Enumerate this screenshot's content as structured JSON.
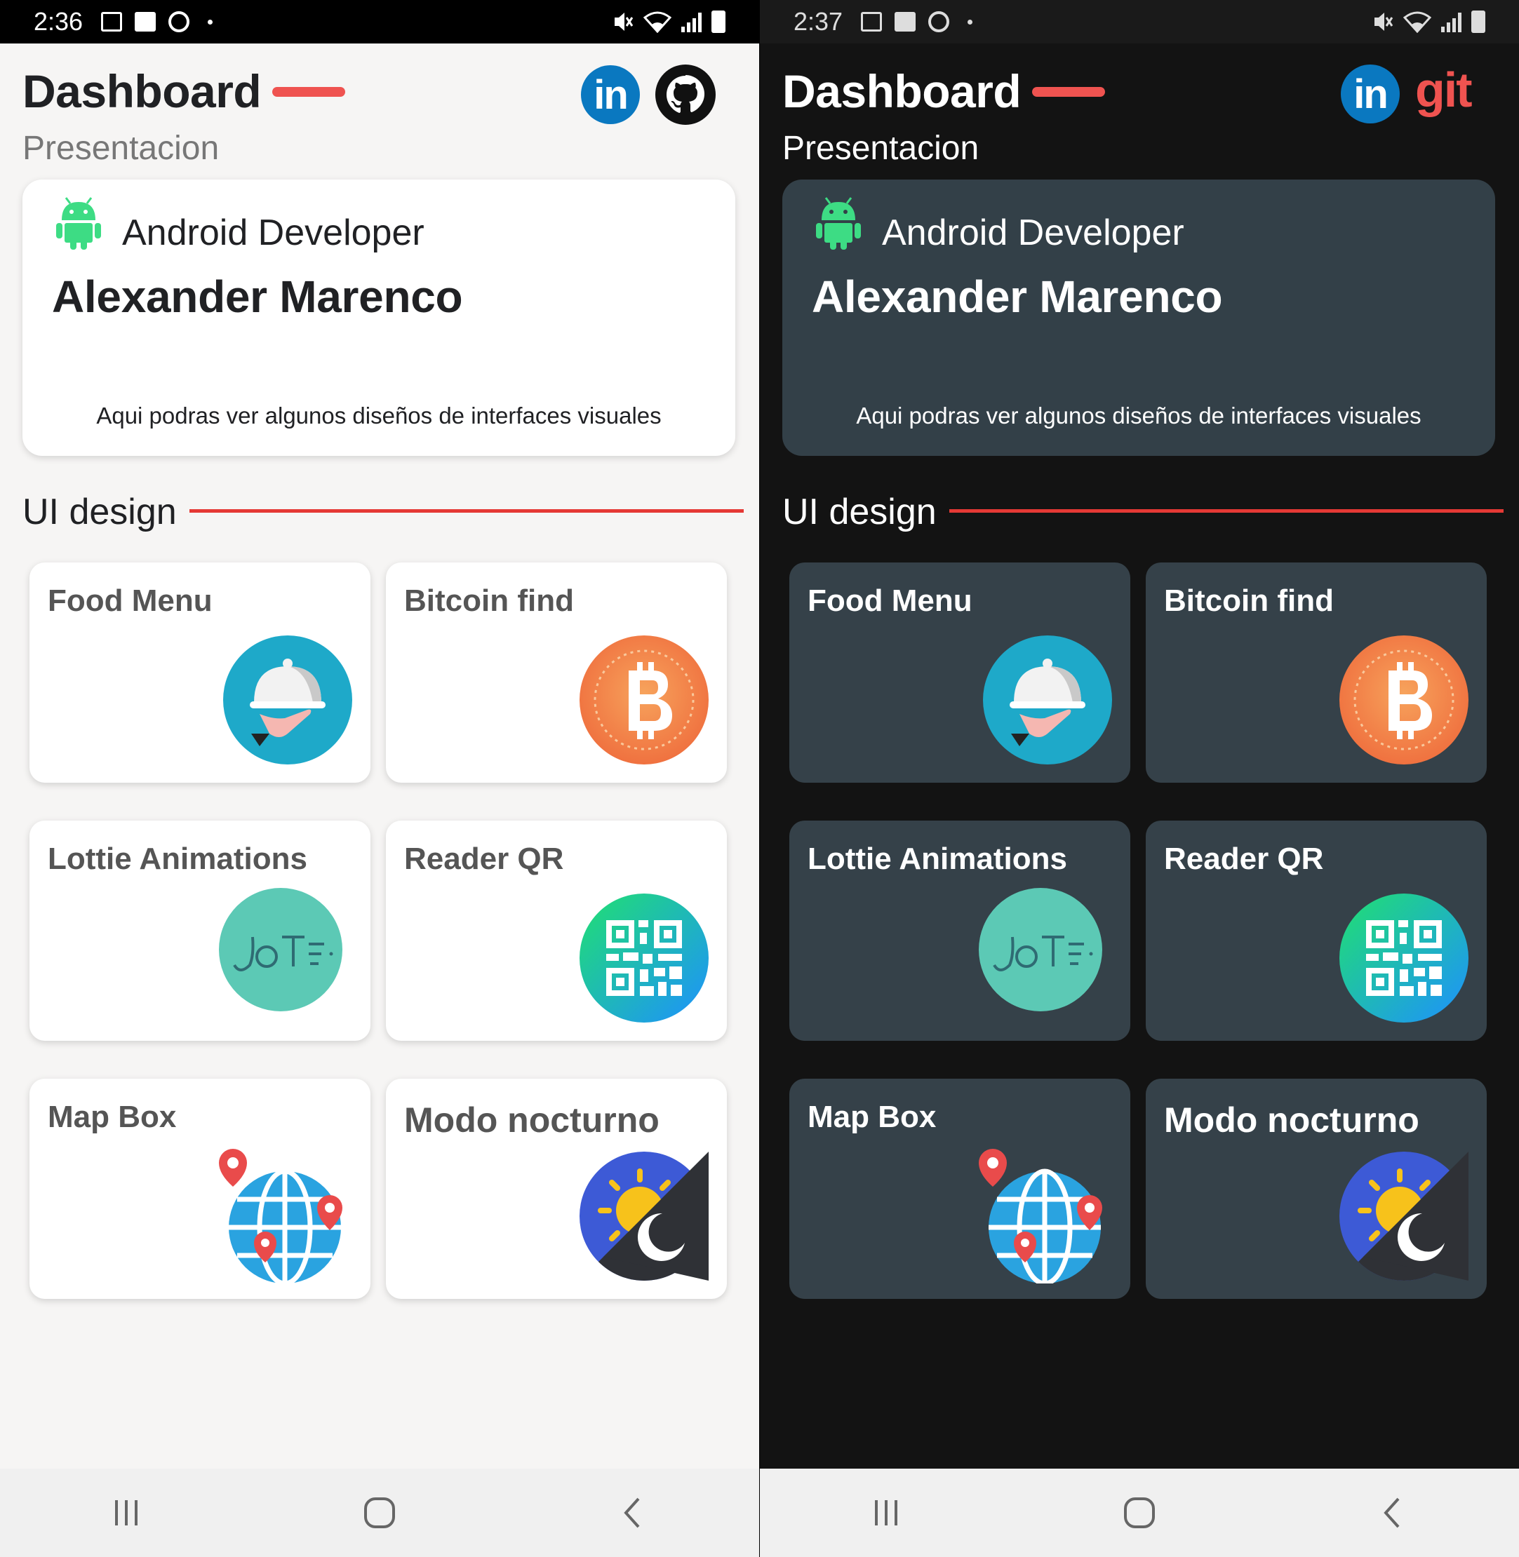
{
  "screens": [
    {
      "theme": "light",
      "status": {
        "time": "2:36"
      },
      "header": {
        "title": "Dashboard",
        "subtitle": "Presentacion",
        "linkedin_label": "in"
      },
      "profile": {
        "role": "Android Developer",
        "name": "Alexander Marenco",
        "tagline": "Aqui podras ver algunos diseños de interfaces visuales"
      },
      "section": {
        "title": "UI design"
      },
      "tiles": [
        {
          "label": "Food Menu",
          "icon": "food-menu-icon"
        },
        {
          "label": "Bitcoin find",
          "icon": "bitcoin-icon"
        },
        {
          "label": "Lottie Animations",
          "icon": "lottie-icon"
        },
        {
          "label": "Reader QR",
          "icon": "qr-code-icon"
        },
        {
          "label": "Map Box",
          "icon": "globe-map-icon"
        },
        {
          "label": "Modo nocturno",
          "icon": "day-night-icon"
        }
      ]
    },
    {
      "theme": "dark",
      "status": {
        "time": "2:37"
      },
      "header": {
        "title": "Dashboard",
        "subtitle": "Presentacion",
        "linkedin_label": "in",
        "git_label": "git"
      },
      "profile": {
        "role": "Android Developer",
        "name": "Alexander Marenco",
        "tagline": "Aqui podras ver algunos diseños de interfaces visuales"
      },
      "section": {
        "title": "UI design"
      },
      "tiles": [
        {
          "label": "Food Menu",
          "icon": "food-menu-icon"
        },
        {
          "label": "Bitcoin find",
          "icon": "bitcoin-icon"
        },
        {
          "label": "Lottie Animations",
          "icon": "lottie-icon"
        },
        {
          "label": "Reader QR",
          "icon": "qr-code-icon"
        },
        {
          "label": "Map Box",
          "icon": "globe-map-icon"
        },
        {
          "label": "Modo nocturno",
          "icon": "day-night-icon"
        }
      ]
    }
  ],
  "colors": {
    "accent": "#ef5350",
    "linkedin": "#0a78c0",
    "android": "#3ddc84",
    "light_bg": "#f6f5f4",
    "dark_bg": "#131313",
    "dark_card": "#354149"
  }
}
